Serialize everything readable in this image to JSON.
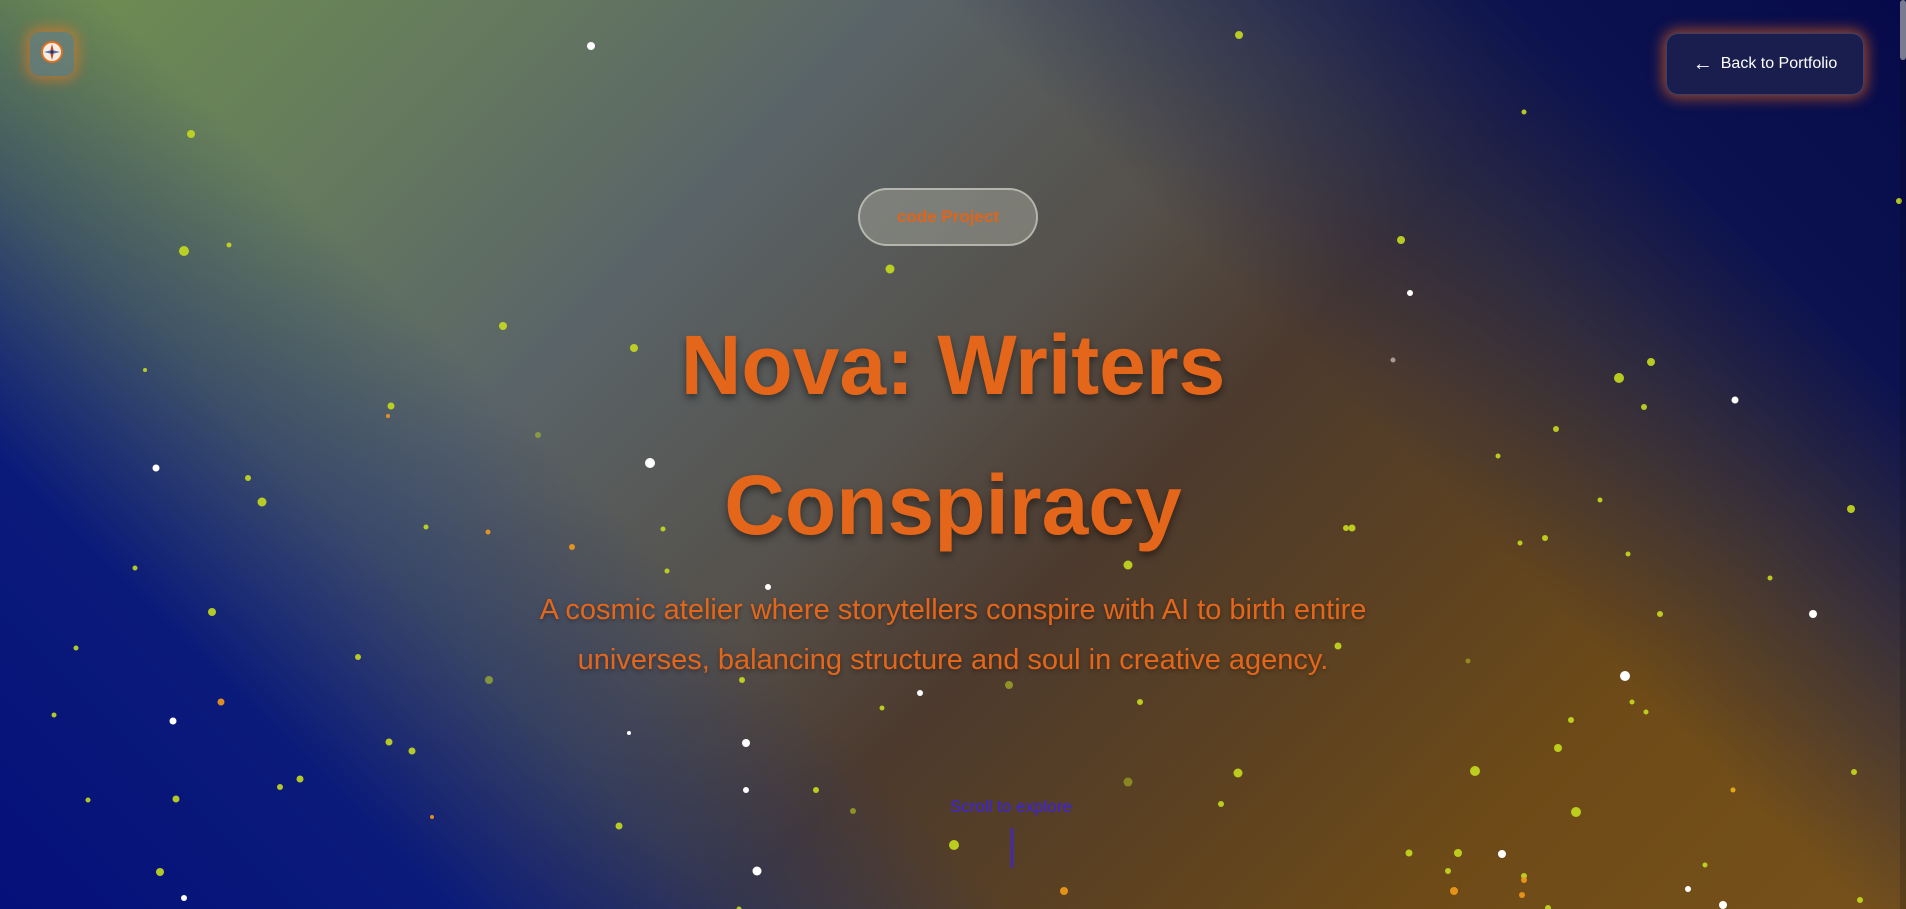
{
  "header": {
    "logo_icon": "compass-icon",
    "back_button": {
      "icon": "arrow-left-icon",
      "label": "Back to Portfolio"
    }
  },
  "hero": {
    "badge": "code Project",
    "title_line1": "Nova: Writers",
    "title_line2": "Conspiracy",
    "subtitle_line1": "A cosmic atelier where storytellers conspire with AI to birth entire",
    "subtitle_line2": "universes, balancing structure and soul in creative agency.",
    "scroll_hint": "Scroll to explore"
  },
  "colors": {
    "accent": "#e3661a",
    "scroll_hint": "#3a22e6",
    "button_bg": "#1a1e4e"
  }
}
